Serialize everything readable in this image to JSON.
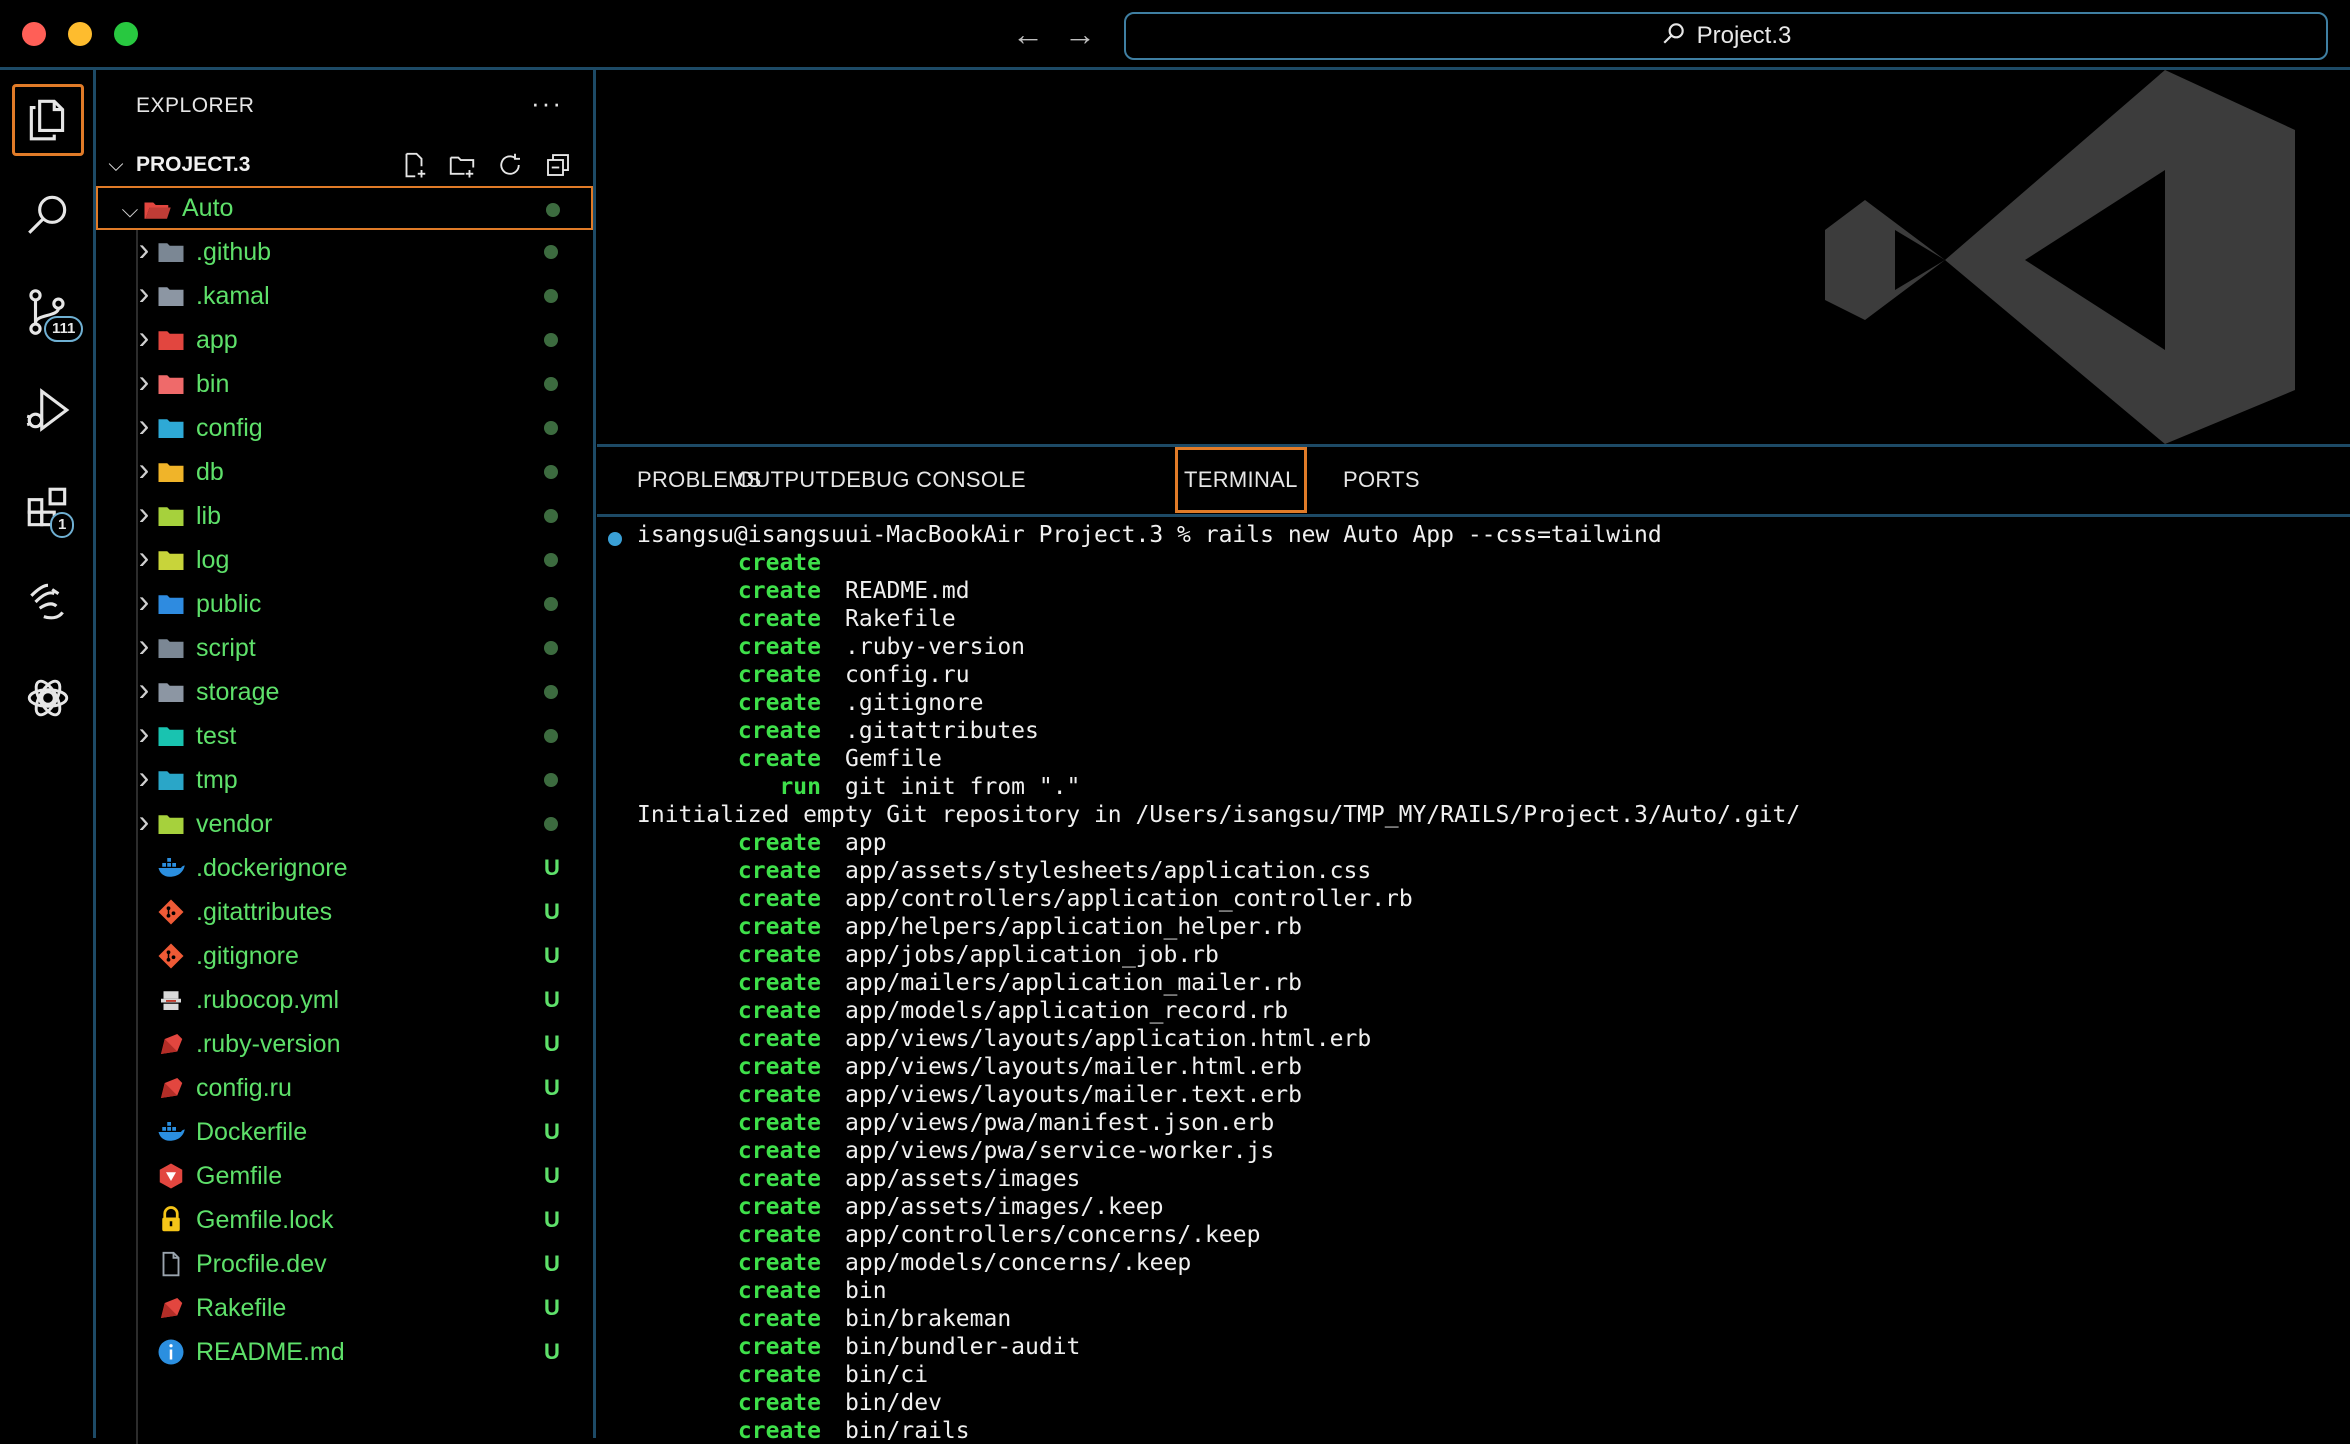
{
  "window": {
    "search_title": "Project.3",
    "back_arrow": "←",
    "forward_arrow": "→"
  },
  "activity_bar": {
    "items": [
      {
        "name": "explorer-icon",
        "active": true
      },
      {
        "name": "search-icon"
      },
      {
        "name": "source-control-icon",
        "badge": "111"
      },
      {
        "name": "run-debug-icon"
      },
      {
        "name": "extensions-icon",
        "badge": "1"
      },
      {
        "name": "hand-icon"
      },
      {
        "name": "chatgpt-icon"
      }
    ]
  },
  "sidebar": {
    "header": "EXPLORER",
    "more": "···",
    "project": "PROJECT.3",
    "tree": [
      {
        "label": "Auto",
        "type": "folder-open",
        "status": "dot",
        "icon_color": "#e2463f",
        "selected": true
      },
      {
        "label": ".github",
        "type": "folder",
        "status": "dot",
        "icon_color": "#7b8794"
      },
      {
        "label": ".kamal",
        "type": "folder",
        "status": "dot",
        "icon_color": "#8c96a3"
      },
      {
        "label": "app",
        "type": "folder",
        "status": "dot",
        "icon_color": "#e2463f"
      },
      {
        "label": "bin",
        "type": "folder",
        "status": "dot",
        "icon_color": "#ef6a6a"
      },
      {
        "label": "config",
        "type": "folder",
        "status": "dot",
        "icon_color": "#2ea9d6"
      },
      {
        "label": "db",
        "type": "folder",
        "status": "dot",
        "icon_color": "#f0b429"
      },
      {
        "label": "lib",
        "type": "folder",
        "status": "dot",
        "icon_color": "#a6d13c"
      },
      {
        "label": "log",
        "type": "folder",
        "status": "dot",
        "icon_color": "#c8d43a"
      },
      {
        "label": "public",
        "type": "folder",
        "status": "dot",
        "icon_color": "#2e8be0"
      },
      {
        "label": "script",
        "type": "folder",
        "status": "dot",
        "icon_color": "#7b8794"
      },
      {
        "label": "storage",
        "type": "folder",
        "status": "dot",
        "icon_color": "#8c96a3"
      },
      {
        "label": "test",
        "type": "folder",
        "status": "dot",
        "icon_color": "#19c3b0"
      },
      {
        "label": "tmp",
        "type": "folder",
        "status": "dot",
        "icon_color": "#2aa6c8"
      },
      {
        "label": "vendor",
        "type": "folder",
        "status": "dot",
        "icon_color": "#a6d13c"
      },
      {
        "label": ".dockerignore",
        "type": "file",
        "status": "U",
        "icon": "docker",
        "icon_color": "#2b8fe0"
      },
      {
        "label": ".gitattributes",
        "type": "file",
        "status": "U",
        "icon": "git",
        "icon_color": "#ef5a36"
      },
      {
        "label": ".gitignore",
        "type": "file",
        "status": "U",
        "icon": "git",
        "icon_color": "#ef5a36"
      },
      {
        "label": ".rubocop.yml",
        "type": "file",
        "status": "U",
        "icon": "rubocop",
        "icon_color": "#d9d9d9"
      },
      {
        "label": ".ruby-version",
        "type": "file",
        "status": "U",
        "icon": "ruby",
        "icon_color": "#e2463f"
      },
      {
        "label": "config.ru",
        "type": "file",
        "status": "U",
        "icon": "ruby",
        "icon_color": "#e2463f"
      },
      {
        "label": "Dockerfile",
        "type": "file",
        "status": "U",
        "icon": "docker",
        "icon_color": "#2b8fe0"
      },
      {
        "label": "Gemfile",
        "type": "file",
        "status": "U",
        "icon": "gem",
        "icon_color": "#e2463f"
      },
      {
        "label": "Gemfile.lock",
        "type": "file",
        "status": "U",
        "icon": "lock",
        "icon_color": "#f5c518"
      },
      {
        "label": "Procfile.dev",
        "type": "file",
        "status": "U",
        "icon": "doc",
        "icon_color": "#9aa4ae"
      },
      {
        "label": "Rakefile",
        "type": "file",
        "status": "U",
        "icon": "ruby",
        "icon_color": "#e2463f"
      },
      {
        "label": "README.md",
        "type": "file",
        "status": "U",
        "icon": "info",
        "icon_color": "#2b8fe0"
      }
    ]
  },
  "panel": {
    "tabs": [
      "PROBLEMS",
      "OUTPUT",
      "DEBUG CONSOLE",
      "TERMINAL",
      "PORTS"
    ],
    "active_tab": "TERMINAL",
    "terminal": {
      "prompt": "isangsu@isangsuui-MacBookAir Project.3 % rails new Auto App --css=tailwind",
      "lines": [
        {
          "kw": "create",
          "text": ""
        },
        {
          "kw": "create",
          "text": "README.md"
        },
        {
          "kw": "create",
          "text": "Rakefile"
        },
        {
          "kw": "create",
          "text": ".ruby-version"
        },
        {
          "kw": "create",
          "text": "config.ru"
        },
        {
          "kw": "create",
          "text": ".gitignore"
        },
        {
          "kw": "create",
          "text": ".gitattributes"
        },
        {
          "kw": "create",
          "text": "Gemfile"
        },
        {
          "kw": "run",
          "text": "git init from \".\""
        },
        {
          "kw": "",
          "text": "Initialized empty Git repository in /Users/isangsu/TMP_MY/RAILS/Project.3/Auto/.git/"
        },
        {
          "kw": "create",
          "text": "app"
        },
        {
          "kw": "create",
          "text": "app/assets/stylesheets/application.css"
        },
        {
          "kw": "create",
          "text": "app/controllers/application_controller.rb"
        },
        {
          "kw": "create",
          "text": "app/helpers/application_helper.rb"
        },
        {
          "kw": "create",
          "text": "app/jobs/application_job.rb"
        },
        {
          "kw": "create",
          "text": "app/mailers/application_mailer.rb"
        },
        {
          "kw": "create",
          "text": "app/models/application_record.rb"
        },
        {
          "kw": "create",
          "text": "app/views/layouts/application.html.erb"
        },
        {
          "kw": "create",
          "text": "app/views/layouts/mailer.html.erb"
        },
        {
          "kw": "create",
          "text": "app/views/layouts/mailer.text.erb"
        },
        {
          "kw": "create",
          "text": "app/views/pwa/manifest.json.erb"
        },
        {
          "kw": "create",
          "text": "app/views/pwa/service-worker.js"
        },
        {
          "kw": "create",
          "text": "app/assets/images"
        },
        {
          "kw": "create",
          "text": "app/assets/images/.keep"
        },
        {
          "kw": "create",
          "text": "app/controllers/concerns/.keep"
        },
        {
          "kw": "create",
          "text": "app/models/concerns/.keep"
        },
        {
          "kw": "create",
          "text": "bin"
        },
        {
          "kw": "create",
          "text": "bin/brakeman"
        },
        {
          "kw": "create",
          "text": "bin/bundler-audit"
        },
        {
          "kw": "create",
          "text": "bin/ci"
        },
        {
          "kw": "create",
          "text": "bin/dev"
        },
        {
          "kw": "create",
          "text": "bin/rails"
        }
      ]
    }
  }
}
